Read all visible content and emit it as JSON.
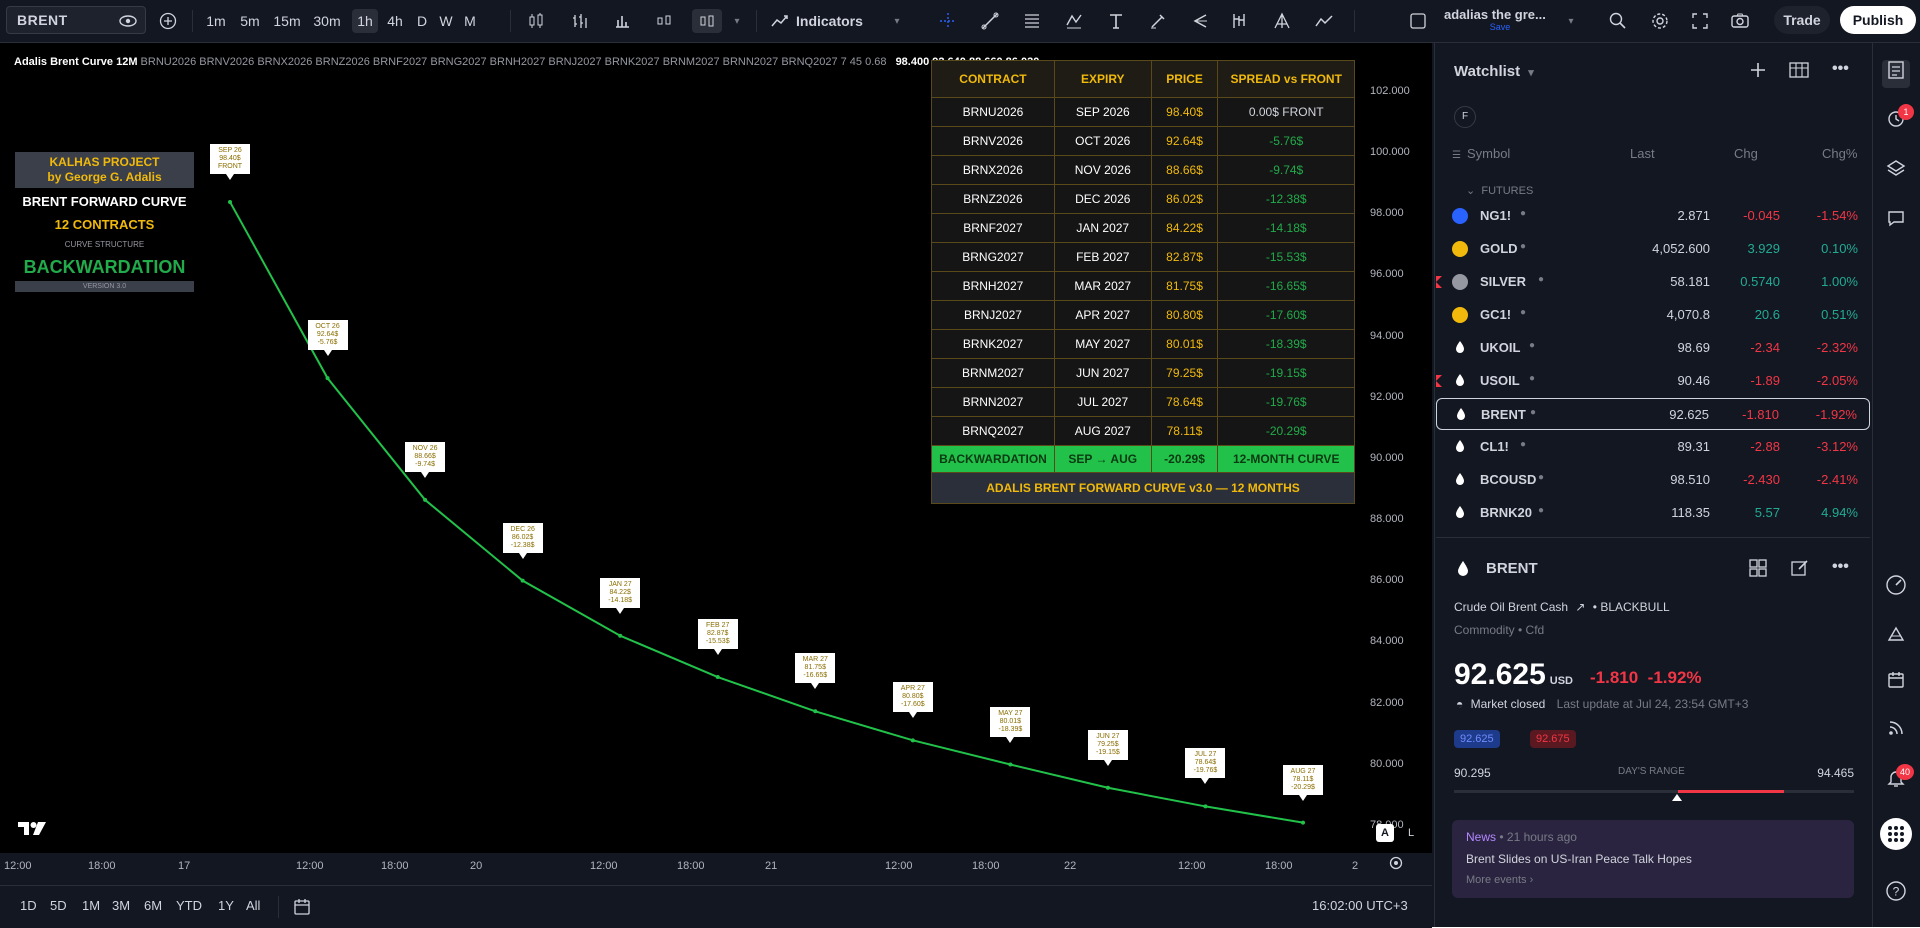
{
  "toolbar": {
    "symbol": "BRENT",
    "intervals": [
      "1m",
      "5m",
      "15m",
      "30m",
      "1h",
      "4h",
      "D",
      "W",
      "M"
    ],
    "active_interval": "1h",
    "indicators_label": "Indicators",
    "layout_title": "adalias the gre...",
    "layout_status": "Save",
    "trade_label": "Trade",
    "publish_label": "Publish"
  },
  "chart": {
    "legend_name": "Adalis Brent Curve 12M",
    "legend_series": "BRNU2026 BRNV2026 BRNX2026 BRNZ2026 BRNF2027 BRNG2027 BRNH2027 BRNJ2027 BRNK2027 BRNM2027 BRNN2027 BRNQ2027 7 45 0.68",
    "legend_values": "98.400 92.640 88.660 86.020",
    "panel": {
      "project": "KALHAS PROJECT",
      "author": "by George G. Adalis",
      "title": "BRENT FORWARD CURVE",
      "contracts": "12 CONTRACTS",
      "structure_label": "CURVE STRUCTURE",
      "structure": "BACKWARDATION",
      "version": "VERSION 3.0"
    },
    "table": {
      "headers": [
        "CONTRACT",
        "EXPIRY",
        "PRICE",
        "SPREAD vs FRONT"
      ],
      "rows": [
        [
          "BRNU2026",
          "SEP 2026",
          "98.40$",
          "0.00$  FRONT"
        ],
        [
          "BRNV2026",
          "OCT 2026",
          "92.64$",
          "-5.76$"
        ],
        [
          "BRNX2026",
          "NOV 2026",
          "88.66$",
          "-9.74$"
        ],
        [
          "BRNZ2026",
          "DEC 2026",
          "86.02$",
          "-12.38$"
        ],
        [
          "BRNF2027",
          "JAN 2027",
          "84.22$",
          "-14.18$"
        ],
        [
          "BRNG2027",
          "FEB 2027",
          "82.87$",
          "-15.53$"
        ],
        [
          "BRNH2027",
          "MAR 2027",
          "81.75$",
          "-16.65$"
        ],
        [
          "BRNJ2027",
          "APR 2027",
          "80.80$",
          "-17.60$"
        ],
        [
          "BRNK2027",
          "MAY 2027",
          "80.01$",
          "-18.39$"
        ],
        [
          "BRNM2027",
          "JUN 2027",
          "79.25$",
          "-19.15$"
        ],
        [
          "BRNN2027",
          "JUL 2027",
          "78.64$",
          "-19.76$"
        ],
        [
          "BRNQ2027",
          "AUG 2027",
          "78.11$",
          "-20.29$"
        ]
      ],
      "summary": [
        "BACKWARDATION",
        "SEP → AUG",
        "-20.29$",
        "12-MONTH CURVE"
      ],
      "footer": "ADALIS BRENT FORWARD CURVE v3.0 — 12 MONTHS"
    },
    "y_ticks": [
      "102.000",
      "100.000",
      "98.000",
      "96.000",
      "94.000",
      "92.000",
      "90.000",
      "88.000",
      "86.000",
      "84.000",
      "82.000",
      "80.000",
      "78.000"
    ],
    "x_ticks": [
      "12:00",
      "18:00",
      "17",
      "12:00",
      "18:00",
      "20",
      "12:00",
      "18:00",
      "21",
      "12:00",
      "18:00",
      "22",
      "12:00",
      "18:00",
      "2"
    ],
    "time": "16:02:00 UTC+3"
  },
  "chart_data": {
    "type": "line",
    "title": "BRENT FORWARD CURVE",
    "xlabel": "",
    "ylabel": "",
    "ylim": [
      77,
      102
    ],
    "categories": [
      "SEP 26",
      "OCT 26",
      "NOV 26",
      "DEC 26",
      "JAN 27",
      "FEB 27",
      "MAR 27",
      "APR 27",
      "MAY 27",
      "JUN 27",
      "JUL 27",
      "AUG 27"
    ],
    "series": [
      {
        "values": [
          98.4,
          92.64,
          88.66,
          86.02,
          84.22,
          82.87,
          81.75,
          80.8,
          80.01,
          79.25,
          78.64,
          78.11
        ]
      }
    ],
    "labels": [
      [
        "SEP 26",
        "98.40$",
        "FRONT"
      ],
      [
        "OCT 26",
        "92.64$",
        "-5.76$"
      ],
      [
        "NOV 26",
        "88.66$",
        "-9.74$"
      ],
      [
        "DEC 26",
        "86.02$",
        "-12.38$"
      ],
      [
        "JAN 27",
        "84.22$",
        "-14.18$"
      ],
      [
        "FEB 27",
        "82.87$",
        "-15.53$"
      ],
      [
        "MAR 27",
        "81.75$",
        "-16.65$"
      ],
      [
        "APR 27",
        "80.80$",
        "-17.60$"
      ],
      [
        "MAY 27",
        "80.01$",
        "-18.39$"
      ],
      [
        "JUN 27",
        "79.25$",
        "-19.15$"
      ],
      [
        "JUL 27",
        "78.64$",
        "-19.76$"
      ],
      [
        "AUG 27",
        "78.11$",
        "-20.29$"
      ]
    ],
    "color": "#22c24a",
    "grid": false
  },
  "bottombar": {
    "ranges": [
      "1D",
      "5D",
      "1M",
      "3M",
      "6M",
      "YTD",
      "1Y",
      "All"
    ]
  },
  "watchlist": {
    "title": "Watchlist",
    "columns": [
      "Symbol",
      "Last",
      "Chg",
      "Chg%"
    ],
    "group": "FUTURES",
    "rows": [
      {
        "symbol": "NG1!",
        "last": "2.871",
        "chg": "-0.045",
        "chgp": "-1.54%",
        "dir": "neg",
        "icon": "blue"
      },
      {
        "symbol": "GOLD",
        "last": "4,052.600",
        "chg": "3.929",
        "chgp": "0.10%",
        "dir": "pos",
        "icon": "gold"
      },
      {
        "symbol": "SILVER",
        "last": "58.181",
        "chg": "0.5740",
        "chgp": "1.00%",
        "dir": "pos",
        "icon": "silver"
      },
      {
        "symbol": "GC1!",
        "last": "4,070.8",
        "chg": "20.6",
        "chgp": "0.51%",
        "dir": "pos",
        "icon": "gold"
      },
      {
        "symbol": "UKOIL",
        "last": "98.69",
        "chg": "-2.34",
        "chgp": "-2.32%",
        "dir": "neg",
        "icon": "drop"
      },
      {
        "symbol": "USOIL",
        "last": "90.46",
        "chg": "-1.89",
        "chgp": "-2.05%",
        "dir": "neg",
        "icon": "drop"
      },
      {
        "symbol": "BRENT",
        "last": "92.625",
        "chg": "-1.810",
        "chgp": "-1.92%",
        "dir": "neg",
        "icon": "drop"
      },
      {
        "symbol": "CL1!",
        "last": "89.31",
        "chg": "-2.88",
        "chgp": "-3.12%",
        "dir": "neg",
        "icon": "drop"
      },
      {
        "symbol": "BCOUSD",
        "last": "98.510",
        "chg": "-2.430",
        "chgp": "-2.41%",
        "dir": "neg",
        "icon": "drop"
      },
      {
        "symbol": "BRNK20",
        "last": "118.35",
        "chg": "5.57",
        "chgp": "4.94%",
        "dir": "pos",
        "icon": "drop"
      }
    ]
  },
  "details": {
    "symbol": "BRENT",
    "name": "Crude Oil Brent Cash",
    "broker": "BLACKBULL",
    "category": "Commodity • Cfd",
    "price": "92.625",
    "currency": "USD",
    "change": "-1.810",
    "change_pct": "-1.92%",
    "status": "Market closed",
    "last_update": "Last update at Jul 24, 23:54 GMT+3",
    "bid": "92.625",
    "ask": "92.675",
    "range_low": "90.295",
    "range_label": "DAY'S RANGE",
    "range_high": "94.465",
    "news_label": "News",
    "news_time": "21 hours ago",
    "news_title": "Brent Slides on US-Iran Peace Talk Hopes",
    "news_more": "More events"
  },
  "sidebar": {
    "alerts_badge": "1",
    "notifications_badge": "40"
  }
}
